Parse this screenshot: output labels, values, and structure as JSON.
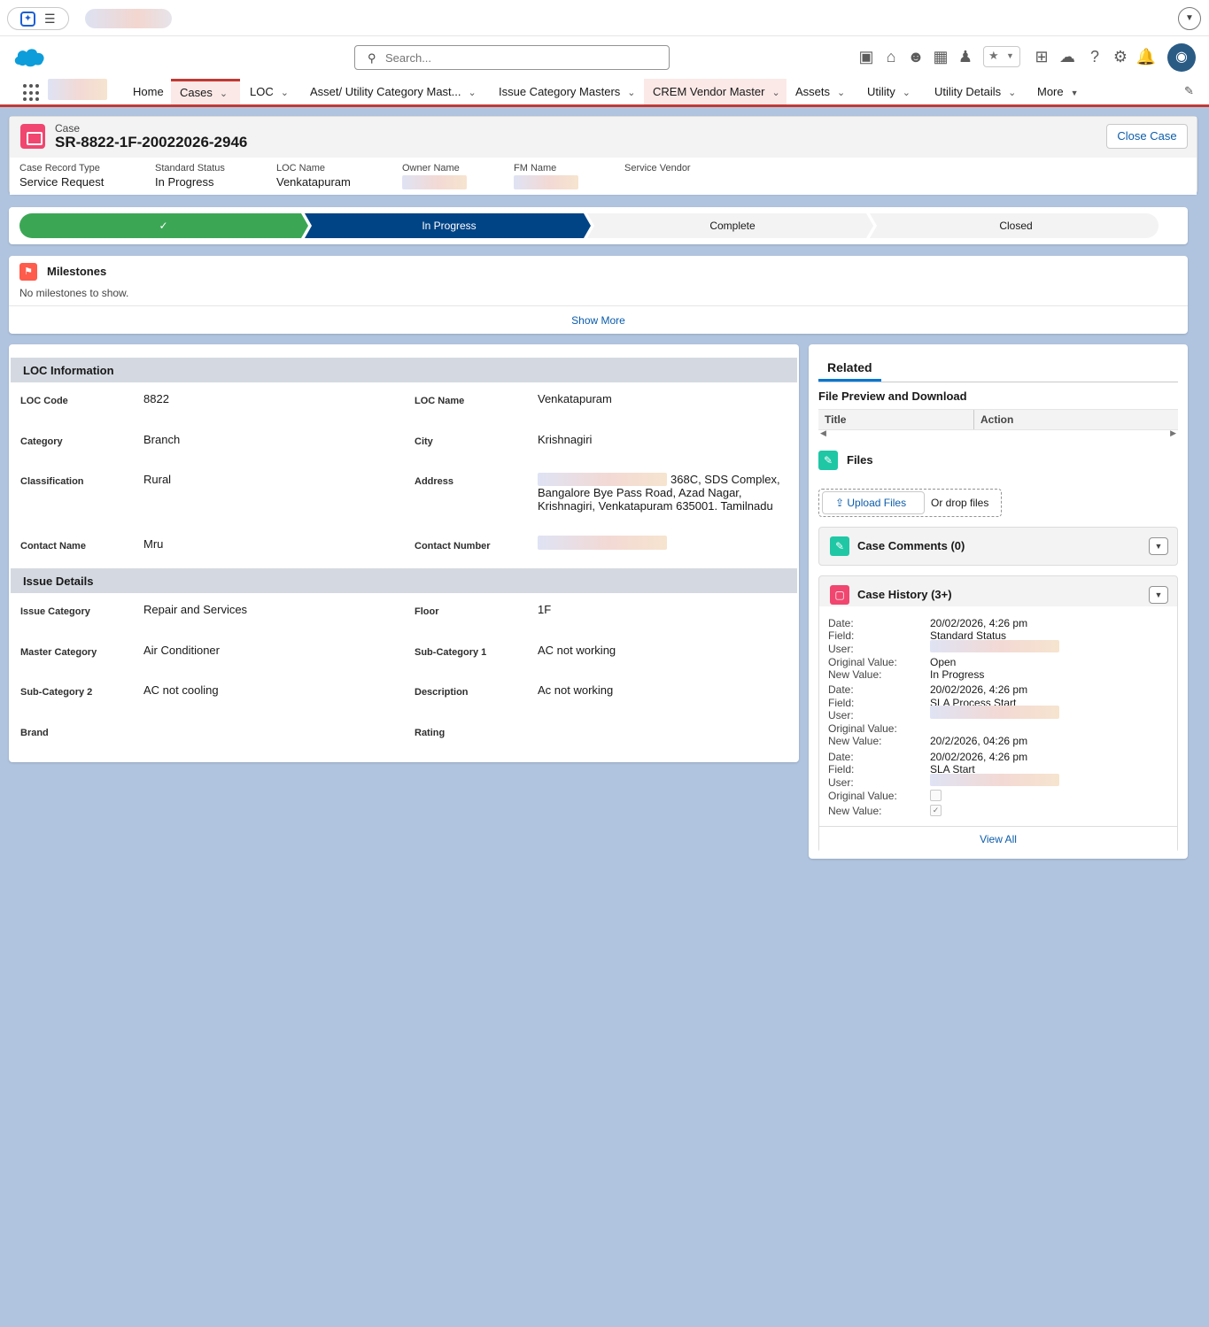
{
  "global": {
    "search_placeholder": "Search..."
  },
  "nav": {
    "items": [
      {
        "label": "Home"
      },
      {
        "label": "Cases"
      },
      {
        "label": "LOC"
      },
      {
        "label": "Asset/ Utility Category Mast..."
      },
      {
        "label": "Issue Category Masters"
      },
      {
        "label": "CREM Vendor Master"
      },
      {
        "label": "Assets"
      },
      {
        "label": "Utility"
      },
      {
        "label": "Utility Details"
      },
      {
        "label": "More"
      }
    ]
  },
  "record": {
    "object_label": "Case",
    "number": "SR-8822-1F-20022026-2946",
    "close_button": "Close Case",
    "highlights": [
      {
        "label": "Case Record Type",
        "value": "Service Request"
      },
      {
        "label": "Standard Status",
        "value": "In Progress"
      },
      {
        "label": "LOC Name",
        "value": "Venkatapuram"
      },
      {
        "label": "Owner Name",
        "value": ""
      },
      {
        "label": "FM Name",
        "value": ""
      },
      {
        "label": "Service Vendor",
        "value": ""
      }
    ]
  },
  "path": {
    "steps": [
      {
        "label": "",
        "state": "complete"
      },
      {
        "label": "In Progress",
        "state": "current"
      },
      {
        "label": "Complete",
        "state": "incomplete"
      },
      {
        "label": "Closed",
        "state": "incomplete"
      }
    ],
    "check_glyph": "✓"
  },
  "milestones": {
    "title": "Milestones",
    "empty_text": "No milestones to show.",
    "show_more": "Show More"
  },
  "details": {
    "loc_section": "LOC Information",
    "issue_section": "Issue Details",
    "loc_code_label": "LOC Code",
    "loc_code": "8822",
    "loc_name_label": "LOC Name",
    "loc_name": "Venkatapuram",
    "category_label": "Category",
    "category": "Branch",
    "city_label": "City",
    "city": "Krishnagiri",
    "classification_label": "Classification",
    "classification": "Rural",
    "address_label": "Address",
    "address_line1": "368C, SDS Complex,",
    "address_line2": "Bangalore Bye Pass Road, Azad Nagar,",
    "address_line3": "Krishnagiri, Venkatapuram 635001. Tamilnadu",
    "contact_name_label": "Contact Name",
    "contact_name": "Mru",
    "contact_number_label": "Contact Number",
    "issue_category_label": "Issue Category",
    "issue_category": "Repair and Services",
    "floor_label": "Floor",
    "floor": "1F",
    "master_category_label": "Master Category",
    "master_category": "Air Conditioner",
    "sub_category_1_label": "Sub-Category 1",
    "sub_category_1": "AC not working",
    "sub_category_2_label": "Sub-Category 2",
    "sub_category_2": "AC not cooling",
    "description_label": "Description",
    "description": "Ac not working",
    "brand_label": "Brand",
    "rating_label": "Rating"
  },
  "related": {
    "tab": "Related",
    "file_preview_title": "File Preview and Download",
    "col_title": "Title",
    "col_action": "Action",
    "files_title": "Files",
    "upload_button": "Upload Files",
    "drop_text": "Or drop files",
    "comments_title": "Case Comments (0)",
    "history_title": "Case History (3+)",
    "view_all": "View All",
    "history_labels": {
      "date": "Date:",
      "field": "Field:",
      "user": "User:",
      "original": "Original Value:",
      "new": "New Value:"
    },
    "history": [
      {
        "date": "20/02/2026, 4:26 pm",
        "field": "Standard Status",
        "original": "Open",
        "new": "In Progress"
      },
      {
        "date": "20/02/2026, 4:26 pm",
        "field": "SLA Process Start",
        "original": "",
        "new": "20/2/2026, 04:26 pm"
      },
      {
        "date": "20/02/2026, 4:26 pm",
        "field": "SLA Start",
        "original_checked": false,
        "new_checked": true
      }
    ]
  },
  "colors": {
    "path_complete": "#3ba755",
    "path_current": "#014486",
    "path_incomplete": "#f3f3f3",
    "nav_accent": "#c23934",
    "link": "#0b5cab"
  }
}
